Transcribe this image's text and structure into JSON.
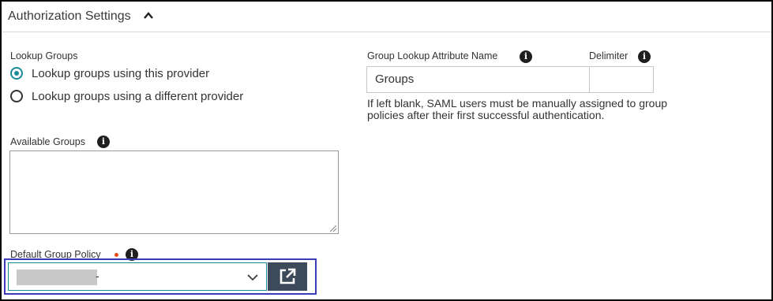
{
  "section": {
    "title": "Authorization Settings",
    "collapse_icon": "chevron-up-icon"
  },
  "lookup_groups": {
    "label": "Lookup Groups",
    "options": [
      {
        "label": "Lookup groups using this provider",
        "checked": true
      },
      {
        "label": "Lookup groups using a different provider",
        "checked": false
      }
    ]
  },
  "group_lookup_attribute": {
    "label": "Group Lookup Attribute Name",
    "info_icon": "i",
    "value": "Groups",
    "help_text": "If left blank, SAML users must be manually assigned to group policies after their first successful authentication."
  },
  "delimiter": {
    "label": "Delimiter",
    "info_icon": "i",
    "value": ""
  },
  "available_groups": {
    "label": "Available Groups",
    "info_icon": "i",
    "value": ""
  },
  "default_group_policy": {
    "label": "Default Group Policy",
    "info_icon": "i",
    "required": true,
    "selected_suffix": "-",
    "open_icon": "external-link-icon"
  },
  "colors": {
    "accent": "#1a8a9a",
    "required": "#e8481a",
    "button": "#3d4a5a",
    "highlight": "#3b3bb8"
  }
}
